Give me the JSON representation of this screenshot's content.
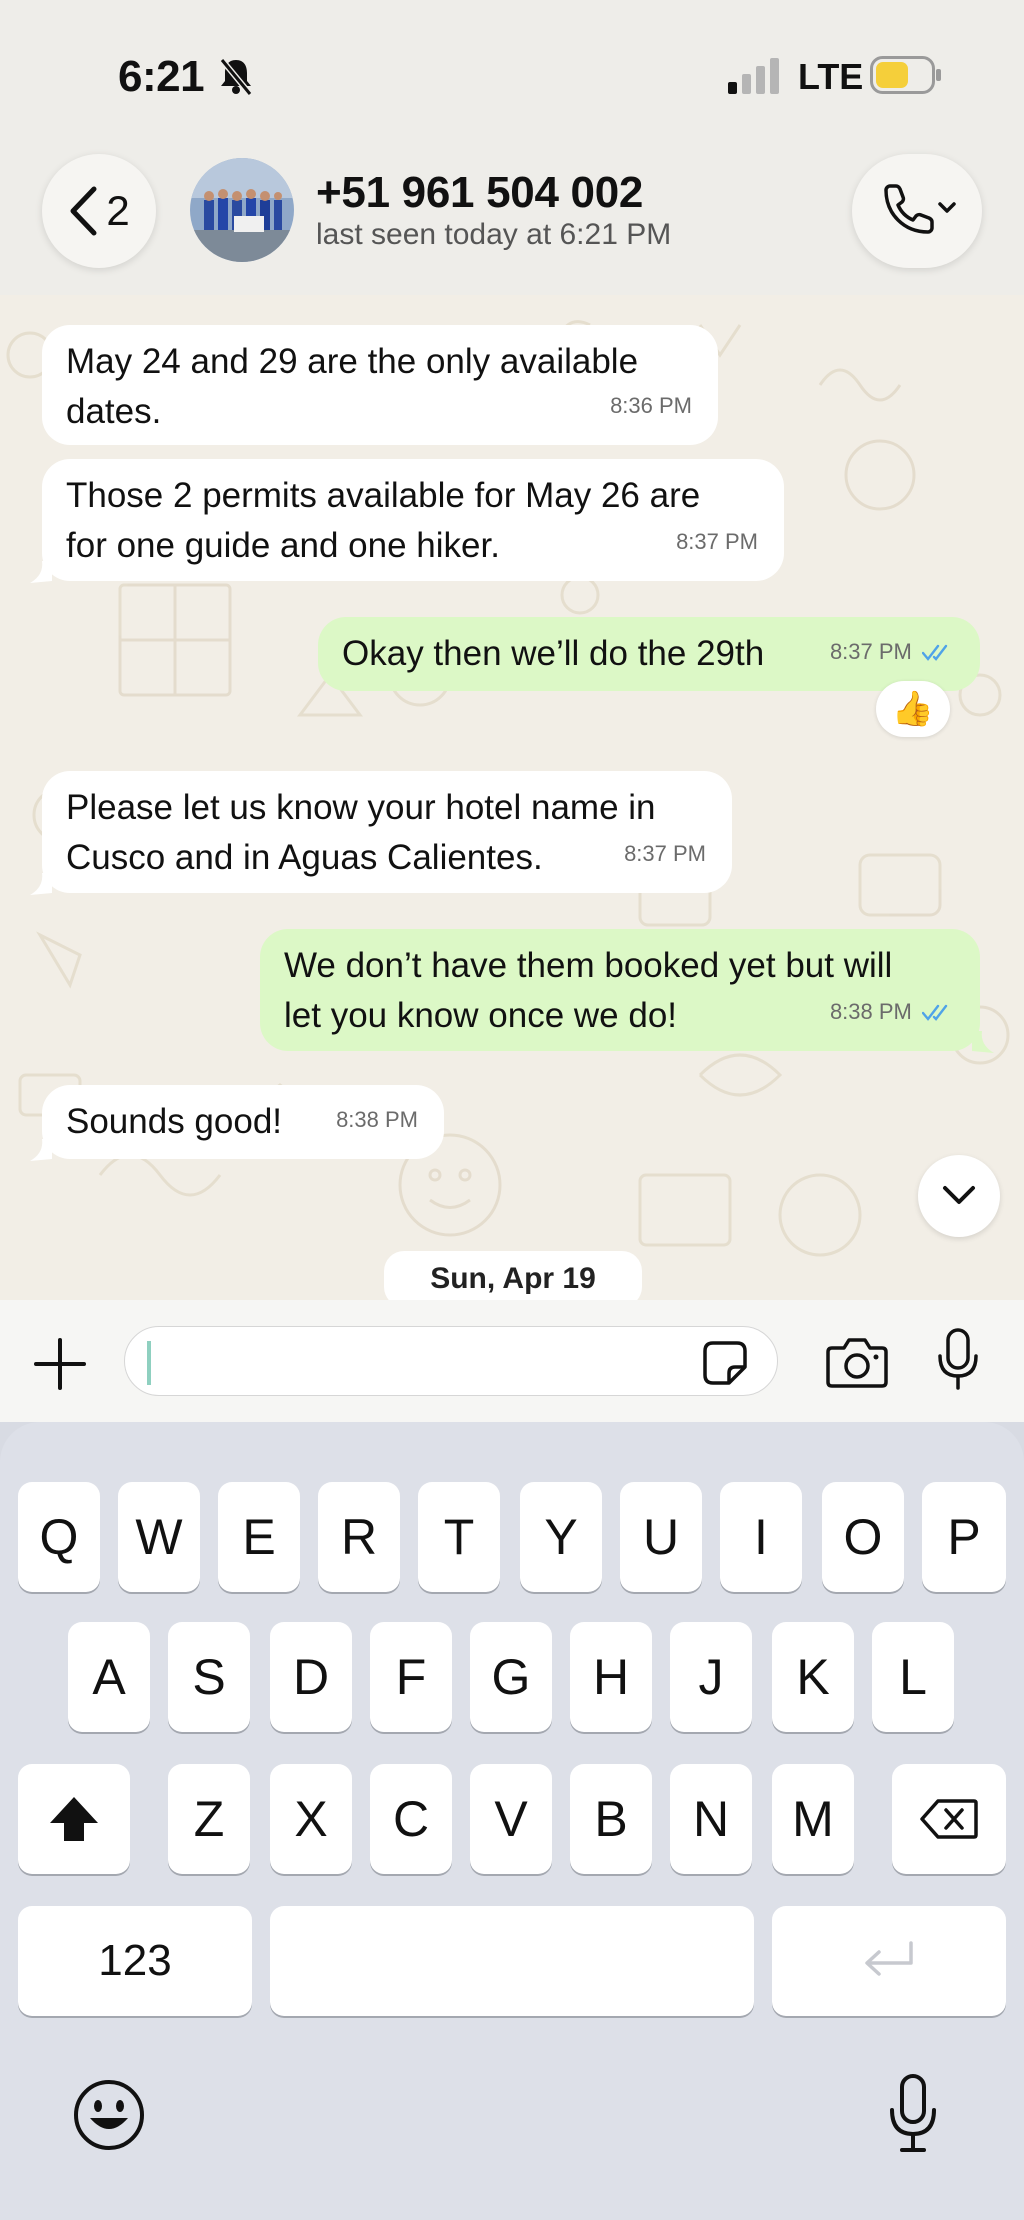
{
  "status_bar": {
    "time": "6:21",
    "network": "LTE"
  },
  "header": {
    "back_count": "2",
    "contact_name": "+51 961 504 002",
    "last_seen": "last seen today at 6:21 PM"
  },
  "messages": [
    {
      "direction": "in",
      "lines": [
        "May 24 and 29 are the only available",
        "dates."
      ],
      "time": "8:36 PM"
    },
    {
      "direction": "in",
      "lines": [
        "Those 2 permits available for May 26 are",
        "for one guide and one hiker."
      ],
      "time": "8:37 PM"
    },
    {
      "direction": "out",
      "lines": [
        "Okay then we’ll do the 29th"
      ],
      "time": "8:37 PM",
      "reaction": "👍"
    },
    {
      "direction": "in",
      "lines": [
        "Please let us know your hotel name in",
        "Cusco and in Aguas Calientes."
      ],
      "time": "8:37 PM"
    },
    {
      "direction": "out",
      "lines": [
        "We don’t have them booked yet but will",
        "let you know once we do!"
      ],
      "time": "8:38 PM"
    },
    {
      "direction": "in",
      "lines": [
        "Sounds good!"
      ],
      "time": "8:38 PM"
    }
  ],
  "date_separator": "Sun, Apr 19",
  "composer": {
    "value": "",
    "icons": [
      "plus-icon",
      "sticker-icon",
      "camera-icon",
      "microphone-icon"
    ]
  },
  "keyboard": {
    "row1": [
      "Q",
      "W",
      "E",
      "R",
      "T",
      "Y",
      "U",
      "I",
      "O",
      "P"
    ],
    "row2": [
      "A",
      "S",
      "D",
      "F",
      "G",
      "H",
      "J",
      "K",
      "L"
    ],
    "row3": [
      "Z",
      "X",
      "C",
      "V",
      "B",
      "N",
      "M"
    ],
    "numbers_key": "123",
    "icons": [
      "shift-icon",
      "backspace-icon",
      "return-icon",
      "emoji-icon",
      "dictation-icon"
    ]
  },
  "colors": {
    "incoming_bubble": "#ffffff",
    "outgoing_bubble": "#dcf8c6",
    "read_ticks": "#4fa3e8",
    "chat_background": "#f2eee6",
    "keyboard_background": "#dde0e8"
  }
}
